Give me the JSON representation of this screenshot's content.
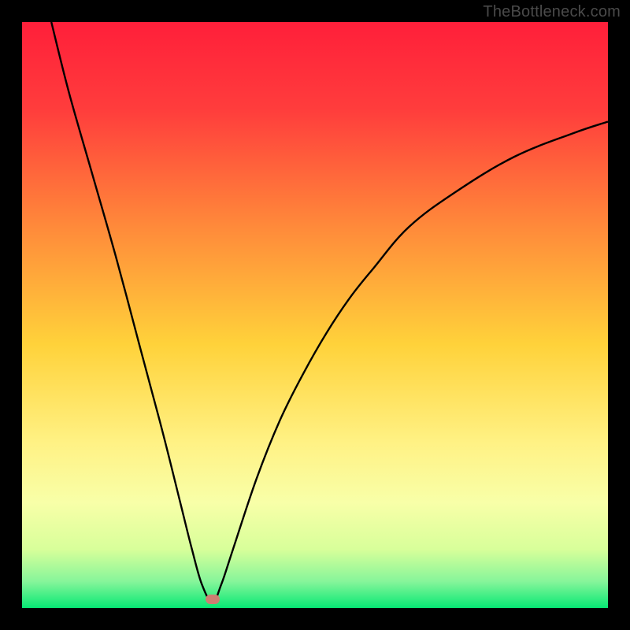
{
  "watermark": "TheBottleneck.com",
  "chart_data": {
    "type": "line",
    "title": "",
    "xlabel": "",
    "ylabel": "",
    "xlim": [
      0,
      100
    ],
    "ylim": [
      0,
      100
    ],
    "grid": false,
    "series": [
      {
        "name": "bottleneck-curve",
        "color": "#000000",
        "x": [
          5,
          8,
          12,
          16,
          20,
          24,
          27,
          29,
          30.7,
          32.5,
          34,
          36,
          40,
          44,
          48,
          52,
          56,
          60,
          66,
          74,
          84,
          94,
          100
        ],
        "y": [
          100,
          88,
          74,
          60,
          45,
          30,
          18,
          10,
          4,
          1,
          4,
          10,
          22,
          32,
          40,
          47,
          53,
          58,
          65,
          71,
          77,
          81,
          83
        ]
      }
    ],
    "marker": {
      "name": "sweet-spot",
      "x": 32.5,
      "y": 1.5,
      "color": "#cd7f72"
    },
    "background": {
      "type": "vertical-gradient",
      "stops": [
        {
          "pos": 0.0,
          "color": "#ff1f3a"
        },
        {
          "pos": 0.15,
          "color": "#ff3d3c"
        },
        {
          "pos": 0.35,
          "color": "#ff8a3a"
        },
        {
          "pos": 0.55,
          "color": "#ffd23a"
        },
        {
          "pos": 0.72,
          "color": "#fff285"
        },
        {
          "pos": 0.82,
          "color": "#f8ffa8"
        },
        {
          "pos": 0.9,
          "color": "#d8ff9a"
        },
        {
          "pos": 0.955,
          "color": "#86f59a"
        },
        {
          "pos": 1.0,
          "color": "#07e874"
        }
      ]
    }
  }
}
